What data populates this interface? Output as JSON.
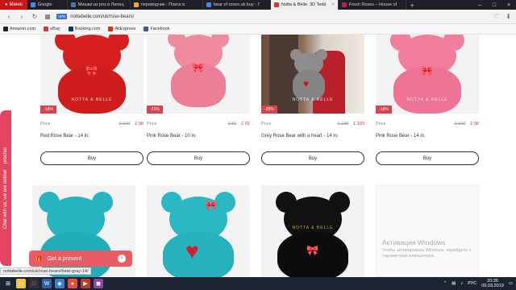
{
  "browser": {
    "menu_label": "Меню",
    "tabs": [
      {
        "title": "Google",
        "color": "#4285f4",
        "active": false
      },
      {
        "title": "Мишки из роз в Липец",
        "color": "#4a76a8",
        "active": false
      },
      {
        "title": "переводчик - Поиск в",
        "color": "#f5a623",
        "active": false
      },
      {
        "title": "bear of roses uk buy - Г",
        "color": "#4285f4",
        "active": false
      },
      {
        "title": "Notta & Belle: 3D Tedd",
        "color": "#d33",
        "active": true
      },
      {
        "title": "Fresh Roses – House of",
        "color": "#c2185b",
        "active": false
      }
    ],
    "new_tab_label": "+",
    "url": "nottabelle.com/uk/rose-bears/",
    "vpn_label": "VPN",
    "bookmarks": [
      {
        "label": "Amazon.com",
        "color": "#222"
      },
      {
        "label": "eBay",
        "color": "#e53238"
      },
      {
        "label": "Booking.com",
        "color": "#003580"
      },
      {
        "label": "AliExpress",
        "color": "#e62e04"
      },
      {
        "label": "Facebook",
        "color": "#3b5998"
      }
    ]
  },
  "products": [
    {
      "badge": "-18%",
      "price_label": "Price",
      "old_price": "£ 120",
      "new_price": "£ 98",
      "name": "Red Rose Bear - 14 in.",
      "buy_label": "Buy",
      "color": "#d62020",
      "watermark": "NOTTA & BELLE"
    },
    {
      "badge": "-21%",
      "price_label": "Price",
      "old_price": "£ 82",
      "new_price": "£ 65",
      "name": "Pink Rose Bear - 10 in.",
      "buy_label": "Buy",
      "color": "#f08aa0",
      "watermark": ""
    },
    {
      "badge": "-20%",
      "price_label": "Price",
      "old_price": "£ 128",
      "new_price": "£ 103",
      "name": "Grey Rose Bear with a heart - 14 in.",
      "buy_label": "Buy",
      "color": "#8d8d8d",
      "watermark": "NOTTA & BELLE"
    },
    {
      "badge": "-18%",
      "price_label": "Price",
      "old_price": "£ 120",
      "new_price": "£ 98",
      "name": "Pink Rose Bear - 14 in.",
      "buy_label": "Buy",
      "color": "#f27d9c",
      "watermark": "NOTTA & BELLE"
    }
  ],
  "second_row": [
    {
      "color": "#26b5c0",
      "watermark": ""
    },
    {
      "color": "#2cb7c4",
      "watermark": ""
    },
    {
      "color": "#111111",
      "watermark": "NOTTA & BELLE"
    }
  ],
  "chat": {
    "prochat_label": "prochat",
    "chat_label": "Chat with us, we are online!"
  },
  "present": {
    "label": "Get a present",
    "close": "×"
  },
  "status_url": "nottabelle.com/uk/rose-bears/bear-gray-14/",
  "windows_activation": {
    "title": "Активация Windows",
    "subtitle": "Чтобы активировать Windows, перейдите к параметрам компьютера."
  },
  "taskbar": {
    "lang": "РУС",
    "time": "20:35",
    "date": "05.03.2019"
  }
}
